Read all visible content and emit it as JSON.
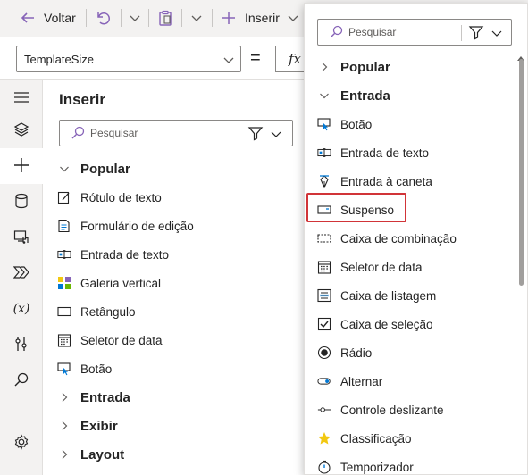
{
  "toolbar": {
    "back_label": "Voltar",
    "insert_label": "Inserir"
  },
  "formula_bar": {
    "property": "TemplateSize",
    "equals": "=",
    "fx": "fx"
  },
  "pane": {
    "title": "Inserir",
    "search_placeholder": "Pesquisar",
    "popular_label": "Popular",
    "items": [
      {
        "label": "Rótulo de texto",
        "icon": "text-label-icon"
      },
      {
        "label": "Formulário de edição",
        "icon": "edit-form-icon"
      },
      {
        "label": "Entrada de texto",
        "icon": "text-input-icon"
      },
      {
        "label": "Galeria vertical",
        "icon": "vertical-gallery-icon"
      },
      {
        "label": "Retângulo",
        "icon": "rectangle-icon"
      },
      {
        "label": "Seletor de data",
        "icon": "date-picker-icon"
      },
      {
        "label": "Botão",
        "icon": "button-icon"
      }
    ],
    "groups": [
      {
        "label": "Entrada"
      },
      {
        "label": "Exibir"
      },
      {
        "label": "Layout"
      }
    ]
  },
  "popup": {
    "search_placeholder": "Pesquisar",
    "popular_label": "Popular",
    "entrada_label": "Entrada",
    "items": [
      {
        "label": "Botão",
        "icon": "button-icon"
      },
      {
        "label": "Entrada de texto",
        "icon": "text-input-icon"
      },
      {
        "label": "Entrada à caneta",
        "icon": "pen-input-icon"
      },
      {
        "label": "Suspenso",
        "icon": "dropdown-icon"
      },
      {
        "label": "Caixa de combinação",
        "icon": "combo-box-icon"
      },
      {
        "label": "Seletor de data",
        "icon": "date-picker-icon"
      },
      {
        "label": "Caixa de listagem",
        "icon": "list-box-icon"
      },
      {
        "label": "Caixa de seleção",
        "icon": "checkbox-icon"
      },
      {
        "label": "Rádio",
        "icon": "radio-icon"
      },
      {
        "label": "Alternar",
        "icon": "toggle-icon"
      },
      {
        "label": "Controle deslizante",
        "icon": "slider-icon"
      },
      {
        "label": "Classificação",
        "icon": "rating-star-icon"
      },
      {
        "label": "Temporizador",
        "icon": "timer-icon"
      }
    ],
    "highlight_color": "#d13438"
  },
  "colors": {
    "accent": "#0078d4",
    "toolbar_bg": "#f3f2f1",
    "highlight": "#d13438"
  }
}
